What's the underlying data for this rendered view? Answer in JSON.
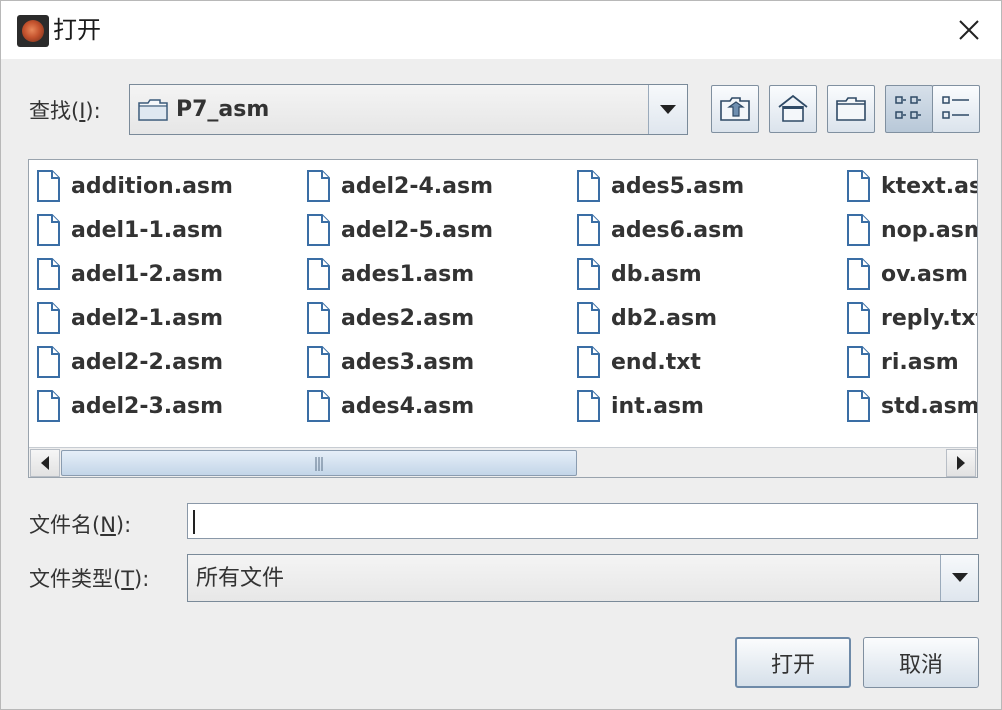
{
  "window": {
    "title": "打开",
    "icon": "app-icon"
  },
  "lookin": {
    "label_prefix": "查找(",
    "label_mnemonic": "I",
    "label_suffix": "):",
    "value": "P7_asm"
  },
  "toolbar": {
    "up_one_level": "up-folder-icon",
    "home": "home-icon",
    "new_folder": "new-folder-icon",
    "list_view": "list-view-icon",
    "details_view": "details-view-icon"
  },
  "files": {
    "columns": [
      [
        "addition.asm",
        "adel1-1.asm",
        "adel1-2.asm",
        "adel2-1.asm",
        "adel2-2.asm",
        "adel2-3.asm"
      ],
      [
        "adel2-4.asm",
        "adel2-5.asm",
        "ades1.asm",
        "ades2.asm",
        "ades3.asm",
        "ades4.asm"
      ],
      [
        "ades5.asm",
        "ades6.asm",
        "db.asm",
        "db2.asm",
        "end.txt",
        "int.asm"
      ],
      [
        "ktext.asm",
        "nop.asm",
        "ov.asm",
        "reply.txt",
        "ri.asm",
        "std.asm"
      ]
    ]
  },
  "filename": {
    "label_prefix": "文件名(",
    "label_mnemonic": "N",
    "label_suffix": "):",
    "value": ""
  },
  "filetype": {
    "label_prefix": "文件类型(",
    "label_mnemonic": "T",
    "label_suffix": "):",
    "value": "所有文件"
  },
  "buttons": {
    "open": "打开",
    "cancel": "取消"
  },
  "colors": {
    "background": "#eeeeee",
    "accent": "#6e8aa8",
    "icon_blue": "#3a6ea5"
  }
}
